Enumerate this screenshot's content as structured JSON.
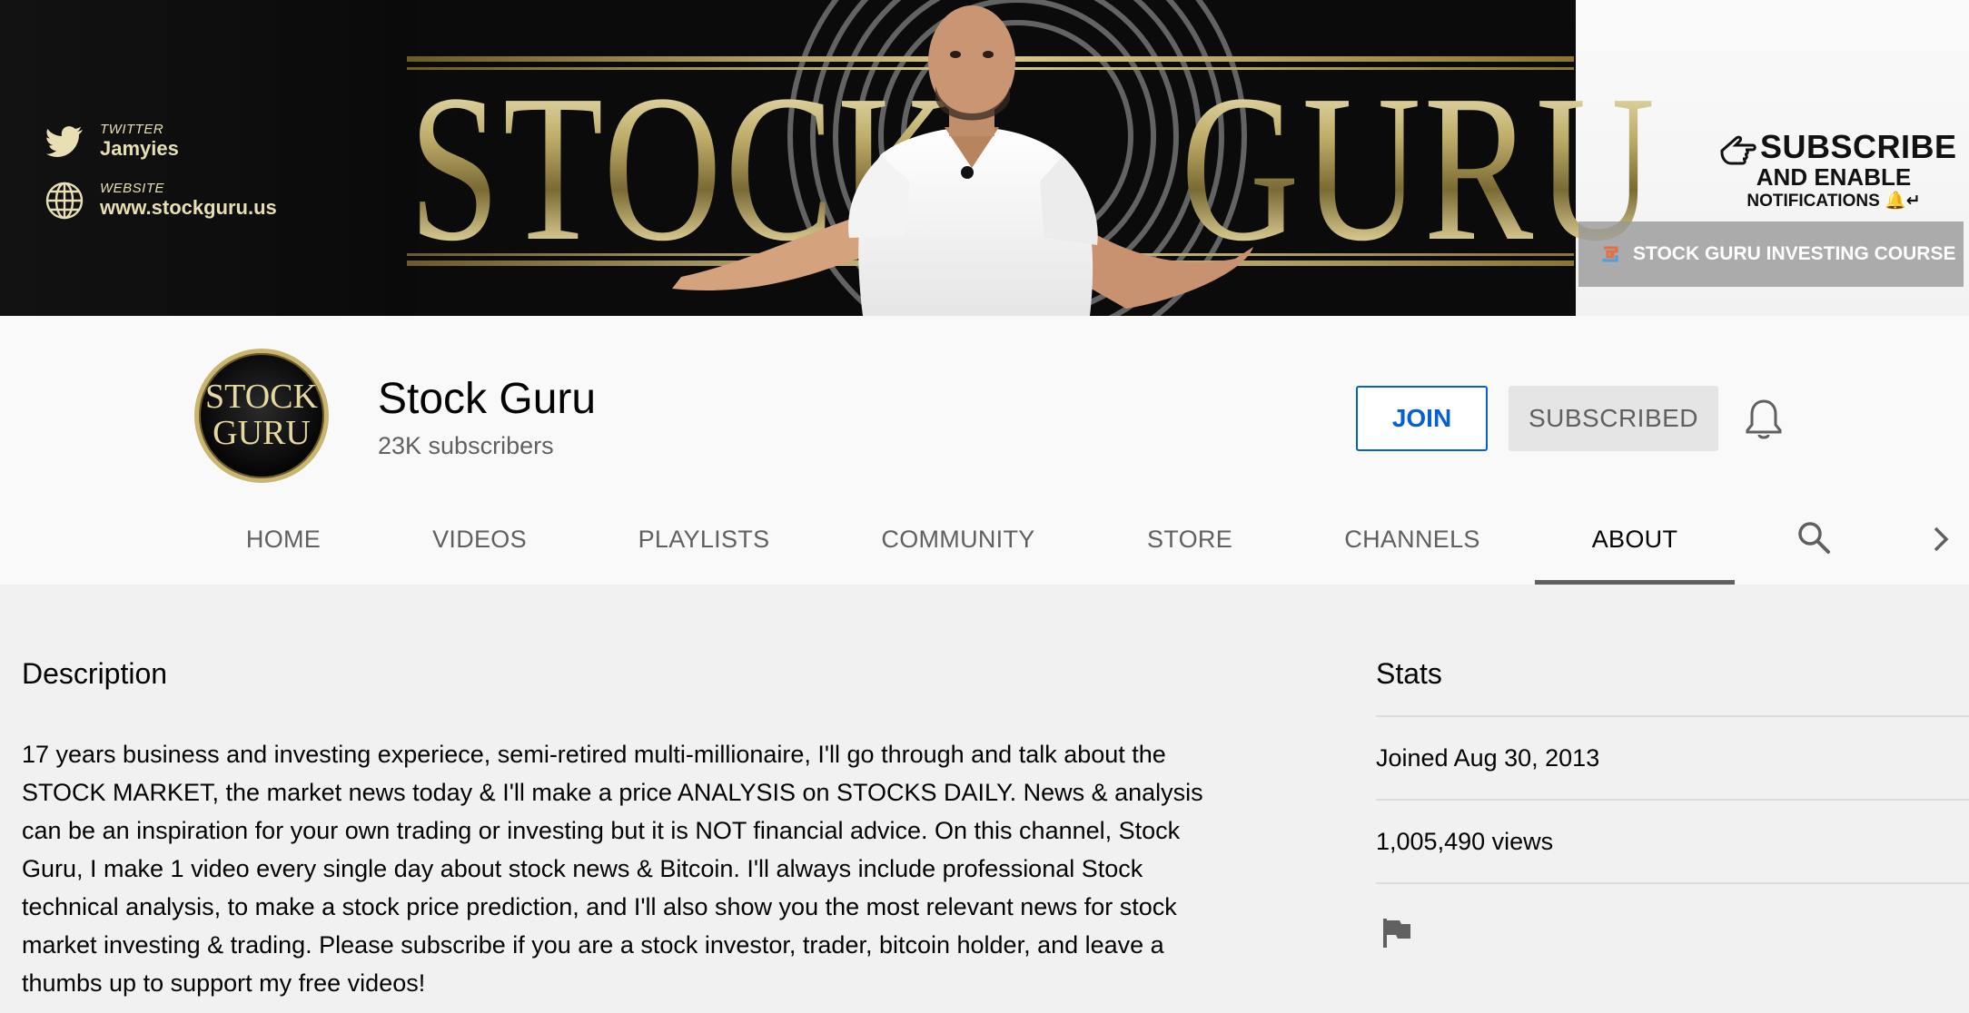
{
  "banner": {
    "title_left": "STOCK",
    "title_right": "GURU",
    "twitter_label": "TWITTER",
    "twitter_handle": "Jamyies",
    "website_label": "WEBSITE",
    "website_url": "www.stockguru.us",
    "promo_line1": "SUBSCRIBE",
    "promo_line2": "AND ENABLE",
    "promo_line3": "NOTIFICATIONS",
    "course_link": "STOCK GURU INVESTING COURSE",
    "colors": {
      "gold": "#c8b56e",
      "dark": "#0b0b0b"
    }
  },
  "channel": {
    "avatar_line1": "STOCK",
    "avatar_line2": "GURU",
    "name": "Stock Guru",
    "subscribers": "23K subscribers",
    "join_label": "JOIN",
    "subscribed_label": "SUBSCRIBED",
    "bell_icon": "bell-icon"
  },
  "tabs": [
    {
      "label": "HOME"
    },
    {
      "label": "VIDEOS"
    },
    {
      "label": "PLAYLISTS"
    },
    {
      "label": "COMMUNITY"
    },
    {
      "label": "STORE"
    },
    {
      "label": "CHANNELS"
    },
    {
      "label": "ABOUT",
      "active": true
    }
  ],
  "about": {
    "description_heading": "Description",
    "description_text": "17 years business and investing experiece, semi-retired multi-millionaire, I'll go through and talk about the STOCK MARKET, the market news today & I'll make a price ANALYSIS on STOCKS DAILY. News & analysis can be an inspiration for your own trading or investing but it is NOT financial advice. On this channel, Stock Guru, I make 1 video every single day about stock news & Bitcoin. I'll always include professional Stock technical analysis, to make a stock price prediction, and I'll also show you the most relevant news for stock market investing & trading. Please subscribe if you are a stock investor, trader, bitcoin holder, and leave a thumbs up to support my free videos!",
    "stats_heading": "Stats",
    "joined": "Joined Aug 30, 2013",
    "views": "1,005,490 views"
  }
}
